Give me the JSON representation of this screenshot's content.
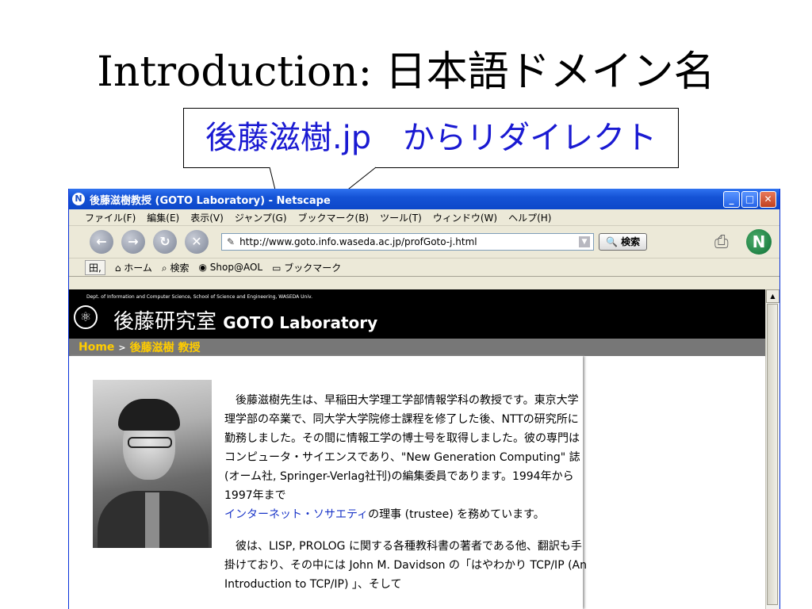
{
  "slide": {
    "title_en": "Introduction: ",
    "title_jp": "日本語ドメイン名",
    "callout": "後藤滋樹.jp　からリダイレクト"
  },
  "browser": {
    "window_title": "後藤滋樹教授 (GOTO Laboratory) - Netscape",
    "menu": [
      "ファイル(F)",
      "編集(E)",
      "表示(V)",
      "ジャンプ(G)",
      "ブックマーク(B)",
      "ツール(T)",
      "ウィンドウ(W)",
      "ヘルプ(H)"
    ],
    "url": "http://www.goto.info.waseda.ac.jp/profGoto-j.html",
    "search_button": "検索",
    "bookmarks": {
      "tab": "田,",
      "home": "ホーム",
      "search": "検索",
      "shop": "Shop@AOL",
      "bookmark": "ブックマーク"
    }
  },
  "site": {
    "dept": "Dept. of Information and Computer Science, School of Science and Engineering, WASEDA Univ.",
    "title_jp": "後藤研究室",
    "title_en": "GOTO Laboratory",
    "breadcrumb_home": "Home",
    "breadcrumb_sep": ">",
    "breadcrumb_current": "後藤滋樹 教授"
  },
  "article": {
    "p1": "後藤滋樹先生は、早稲田大学理工学部情報学科の教授です。東京大学理学部の卒業で、同大学大学院修士課程を修了した後、NTTの研究所に勤務しました。その間に情報工学の博士号を取得しました。彼の専門はコンピュータ・サイエンスであり、\"New Generation Computing\" 誌(オーム社, Springer-Verlag社刊)の編集委員であります。1994年から1997年まで",
    "p1_link": "インターネット・ソサエティ",
    "p1_tail": "の理事 (trustee) を務めています。",
    "p2": "彼は、LISP, PROLOG に関する各種教科書の著者である他、翻訳も手掛けており、その中には John M. Davidson の「はやわかり TCP/IP (An Introduction to TCP/IP) 」、そして"
  },
  "colors": {
    "callout_text": "#1a1ad2",
    "titlebar": "#0c47c9",
    "crumb_highlight": "#ffcc00",
    "link": "#1a35c8"
  }
}
